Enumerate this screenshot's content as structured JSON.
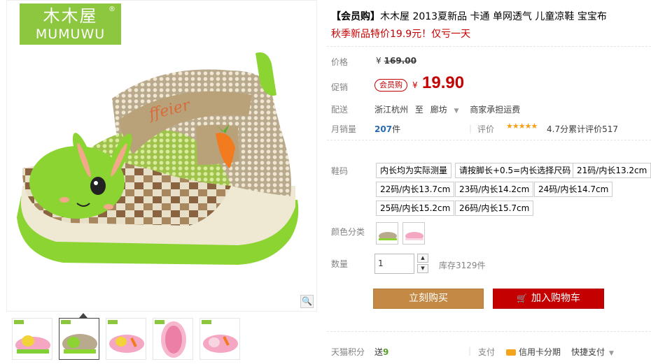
{
  "brand": {
    "logo_cn": "木木屋",
    "logo_reg": "®",
    "logo_en": "MUMUWU"
  },
  "gallery": {
    "zoom_icon": "magnifier-icon"
  },
  "product": {
    "title_tag": "【会员购】",
    "title_text": "木木屋 2013夏新品 卡通 单网透气 儿童凉鞋 宝宝布",
    "subtitle": "秋季新品特价19.9元！仅亏一天"
  },
  "price": {
    "label": "价格",
    "currency": "¥",
    "original": "169.00",
    "promo_label": "促销",
    "member_tag": "会员购",
    "promo_currency": "¥",
    "promo": "19.90"
  },
  "shipping": {
    "label": "配送",
    "from": "浙江杭州",
    "to_word": "至",
    "to": "廊坊",
    "fee": "商家承担运费"
  },
  "sales": {
    "label": "月销量",
    "count": "207",
    "unit": "件",
    "review_label": "评价",
    "stars": "★★★★★",
    "rating_text": "4.7分累计评价517",
    "rating": 4.7
  },
  "sku": {
    "size_label": "鞋码",
    "sizes": [
      "内长均为实际测量",
      "请按脚长+0.5=内长选择尺码",
      "21码/内长13.2cm",
      "22码/内长13.7cm",
      "23码/内长14.2cm",
      "24码/内长14.7cm",
      "25码/内长15.2cm",
      "26码/内长15.7cm"
    ],
    "color_label": "颜色分类",
    "quantity_label": "数量",
    "quantity_value": "1",
    "stock": "库存3129件"
  },
  "actions": {
    "buy": "立刻购买",
    "cart": "加入购物车"
  },
  "footer": {
    "points_label": "天猫积分",
    "points_prefix": "送",
    "points_value": "9",
    "pay_label": "支付",
    "pay_card": "信用卡分期",
    "pay_quick": "快捷支付"
  },
  "colors": {
    "accent_red": "#c40000",
    "buy_orange": "#c48a45",
    "brand_green": "#8dc63f"
  }
}
